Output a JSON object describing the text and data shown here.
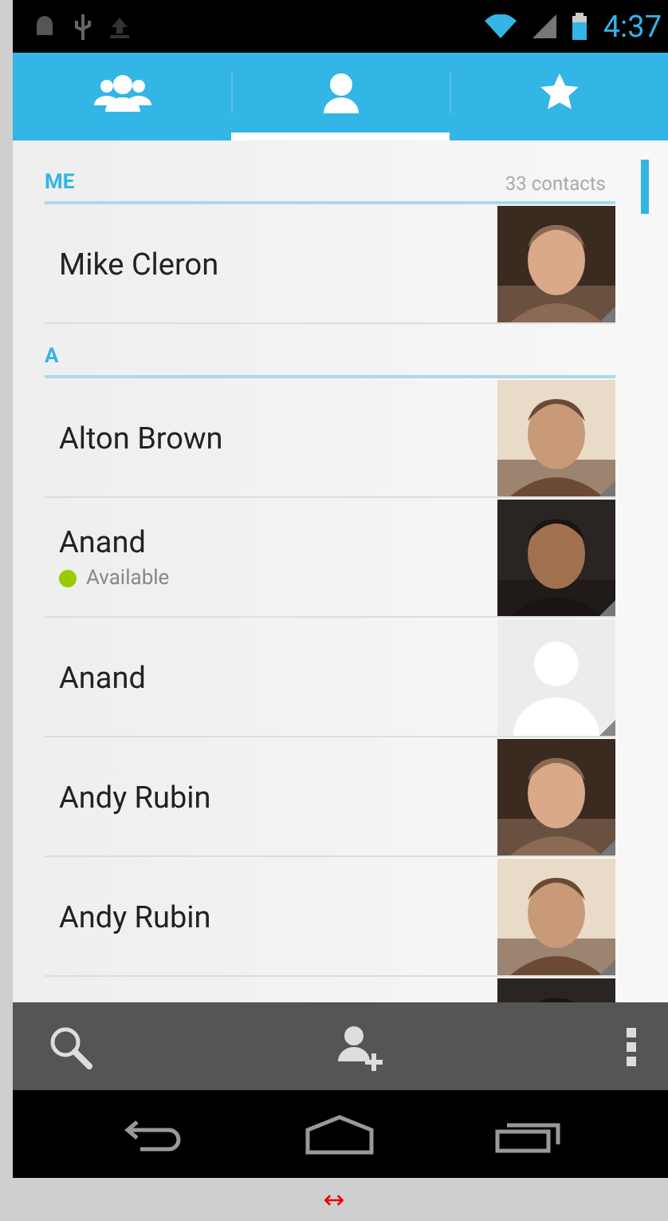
{
  "status_bar": {
    "time": "4:37"
  },
  "tabs": [
    {
      "kind": "groups",
      "selected": false
    },
    {
      "kind": "person",
      "selected": true
    },
    {
      "kind": "favorites",
      "selected": false
    }
  ],
  "sections": [
    {
      "header": "ME",
      "count": "33 contacts",
      "contacts": [
        {
          "name": "Mike Cleron",
          "kind": "picture"
        }
      ]
    },
    {
      "header": "A",
      "contacts": [
        {
          "name": "Alton Brown",
          "kind": "picture"
        },
        {
          "name": "Anand",
          "status": "Available",
          "color": "#99cc00",
          "kind": "picture"
        },
        {
          "name": "Anand",
          "kind": "default"
        },
        {
          "name": "Andy Rubin",
          "kind": "picture"
        },
        {
          "name": "Andy Rubin",
          "kind": "picture"
        },
        {
          "kind": "picture"
        }
      ]
    }
  ],
  "footer_mark": "↔"
}
